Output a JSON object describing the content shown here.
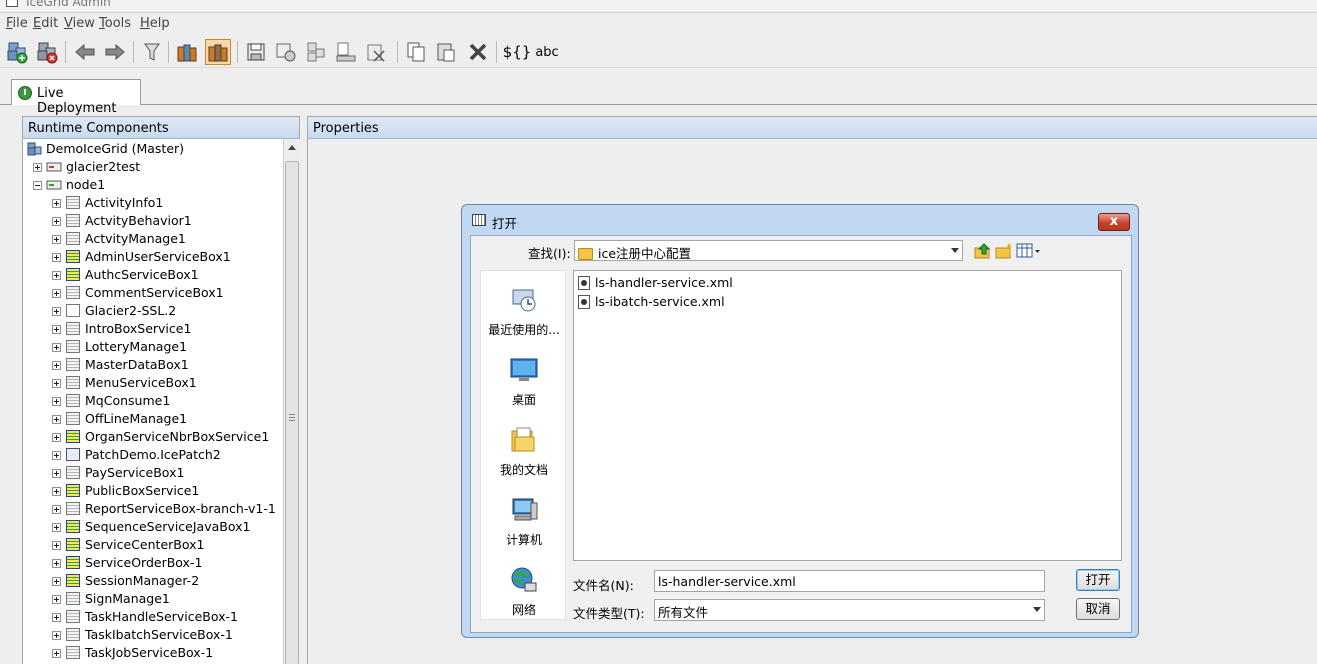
{
  "window": {
    "title": "IceGrid Admin"
  },
  "menu": [
    "File",
    "Edit",
    "View",
    "Tools",
    "Help"
  ],
  "toolbar": {
    "text_buttons": [
      "${}",
      "abc"
    ]
  },
  "tabs": [
    {
      "label": "Live Deployment"
    }
  ],
  "left_panel": {
    "title": "Runtime Components"
  },
  "right_panel": {
    "title": "Properties"
  },
  "tree": {
    "root": "DemoIceGrid (Master)",
    "nodes": [
      {
        "label": "glacier2test",
        "expanded": false
      },
      {
        "label": "node1",
        "expanded": true
      }
    ],
    "servers": [
      {
        "label": "ActivityInfo1",
        "kind": "inactive"
      },
      {
        "label": "ActvityBehavior1",
        "kind": "inactive"
      },
      {
        "label": "ActvityManage1",
        "kind": "inactive"
      },
      {
        "label": "AdminUserServiceBox1",
        "kind": "active"
      },
      {
        "label": "AuthcServiceBox1",
        "kind": "active"
      },
      {
        "label": "CommentServiceBox1",
        "kind": "inactive"
      },
      {
        "label": "Glacier2-SSL.2",
        "kind": "plain"
      },
      {
        "label": "IntroBoxService1",
        "kind": "inactive"
      },
      {
        "label": "LotteryManage1",
        "kind": "inactive"
      },
      {
        "label": "MasterDataBox1",
        "kind": "inactive"
      },
      {
        "label": "MenuServiceBox1",
        "kind": "inactive"
      },
      {
        "label": "MqConsume1",
        "kind": "inactive"
      },
      {
        "label": "OffLineManage1",
        "kind": "inactive"
      },
      {
        "label": "OrganServiceNbrBoxService1",
        "kind": "active"
      },
      {
        "label": "PatchDemo.IcePatch2",
        "kind": "patch"
      },
      {
        "label": "PayServiceBox1",
        "kind": "inactive"
      },
      {
        "label": "PublicBoxService1",
        "kind": "active"
      },
      {
        "label": "ReportServiceBox-branch-v1-1",
        "kind": "inactive"
      },
      {
        "label": "SequenceServiceJavaBox1",
        "kind": "active"
      },
      {
        "label": "ServiceCenterBox1",
        "kind": "active"
      },
      {
        "label": "ServiceOrderBox-1",
        "kind": "active"
      },
      {
        "label": "SessionManager-2",
        "kind": "active"
      },
      {
        "label": "SignManage1",
        "kind": "inactive"
      },
      {
        "label": "TaskHandleServiceBox-1",
        "kind": "inactive"
      },
      {
        "label": "TaskIbatchServiceBox-1",
        "kind": "inactive"
      },
      {
        "label": "TaskJobServiceBox-1",
        "kind": "inactive"
      }
    ]
  },
  "dialog": {
    "title": "打开",
    "close_label": "x",
    "look_in_label": "查找(I):",
    "look_in_value": "ice注册中心配置",
    "places": [
      "最近使用的...",
      "桌面",
      "我的文档",
      "计算机",
      "网络"
    ],
    "files": [
      "ls-handler-service.xml",
      "ls-ibatch-service.xml"
    ],
    "filename_label": "文件名(N):",
    "filename_value": "ls-handler-service.xml",
    "filetype_label": "文件类型(T):",
    "filetype_value": "所有文件",
    "open_label": "打开",
    "cancel_label": "取消"
  },
  "colors": {
    "panel_header": "#c9d9ee",
    "dialog_frame": "#c0d8f2",
    "close_button": "#c4452b"
  }
}
